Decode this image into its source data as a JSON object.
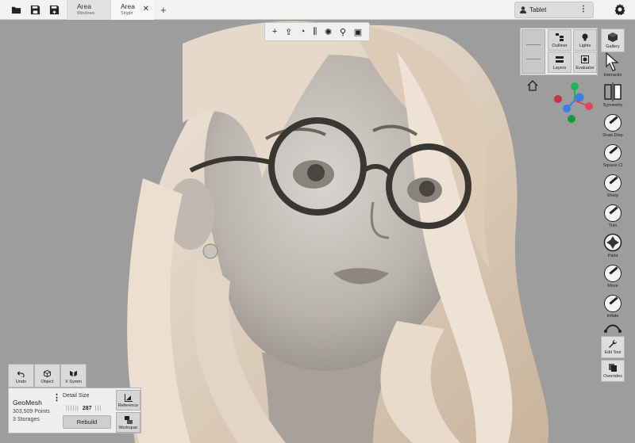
{
  "topbar": {
    "icons": [
      "folder-icon",
      "save-icon",
      "save-as-icon"
    ],
    "tabs": [
      {
        "title": "Area",
        "subtitle": "Windows"
      },
      {
        "title": "Area",
        "subtitle": "Single",
        "close": "✕"
      }
    ],
    "add_tab": "+",
    "device": {
      "label": "Tablet",
      "menu": "⋮"
    },
    "settings_icon": "gear-icon"
  },
  "center_toolbar": {
    "icons": [
      "add-icon",
      "export-icon",
      "undo-circle-icon",
      "sliders-icon",
      "bug-icon",
      "pin-icon",
      "layers-icon"
    ],
    "glyphs": [
      "+",
      "⇪",
      "◔",
      "⫼",
      "✺",
      "⚲",
      "▣"
    ]
  },
  "right_panel": {
    "outliner": "Outliner",
    "lights": "Lights",
    "gallery": "Gallery",
    "layers": "Layers",
    "evaluator": "Evaluator"
  },
  "tools": [
    {
      "label": "Interactio",
      "icon": "cursor-icon"
    },
    {
      "label": "Symmetry",
      "icon": "symmetry-icon"
    },
    {
      "label": "Draw Disp",
      "icon": "draw-icon"
    },
    {
      "label": "Square Cl",
      "icon": "clay-icon"
    },
    {
      "label": "Sharp",
      "icon": "sharp-icon"
    },
    {
      "label": "Trim",
      "icon": "trim-icon"
    },
    {
      "label": "Paint",
      "icon": "paint-icon"
    },
    {
      "label": "Move",
      "icon": "move-icon"
    },
    {
      "label": "Inflate",
      "icon": "inflate-icon"
    },
    {
      "label": "",
      "icon": "curve-icon"
    },
    {
      "label": "Edit Tool",
      "icon": "wrench-icon"
    },
    {
      "label": "Overrides",
      "icon": "overrides-icon"
    }
  ],
  "bottom_left": {
    "undo": "Undo",
    "object": "Object",
    "xsymm": "X Symm",
    "mesh_name": "GeoMesh",
    "points": "303,509 Points",
    "storages": "3 Storages",
    "menu": "⋮",
    "detail_label": "Detail Size",
    "detail_value": "287",
    "ticks_left": "||||||",
    "ticks_right": "|||",
    "rebuild": "Rebuild",
    "reference": "Reference",
    "workspace": "Workspac"
  },
  "colors": {
    "viewport_bg": "#9d9d9d",
    "panel_bg": "#efefef",
    "gizmo_red": "#e0485a",
    "gizmo_green": "#1fb55a",
    "gizmo_blue": "#3c7ee8",
    "skin": "#d8cfc6",
    "hair": "#e6d7c5"
  }
}
